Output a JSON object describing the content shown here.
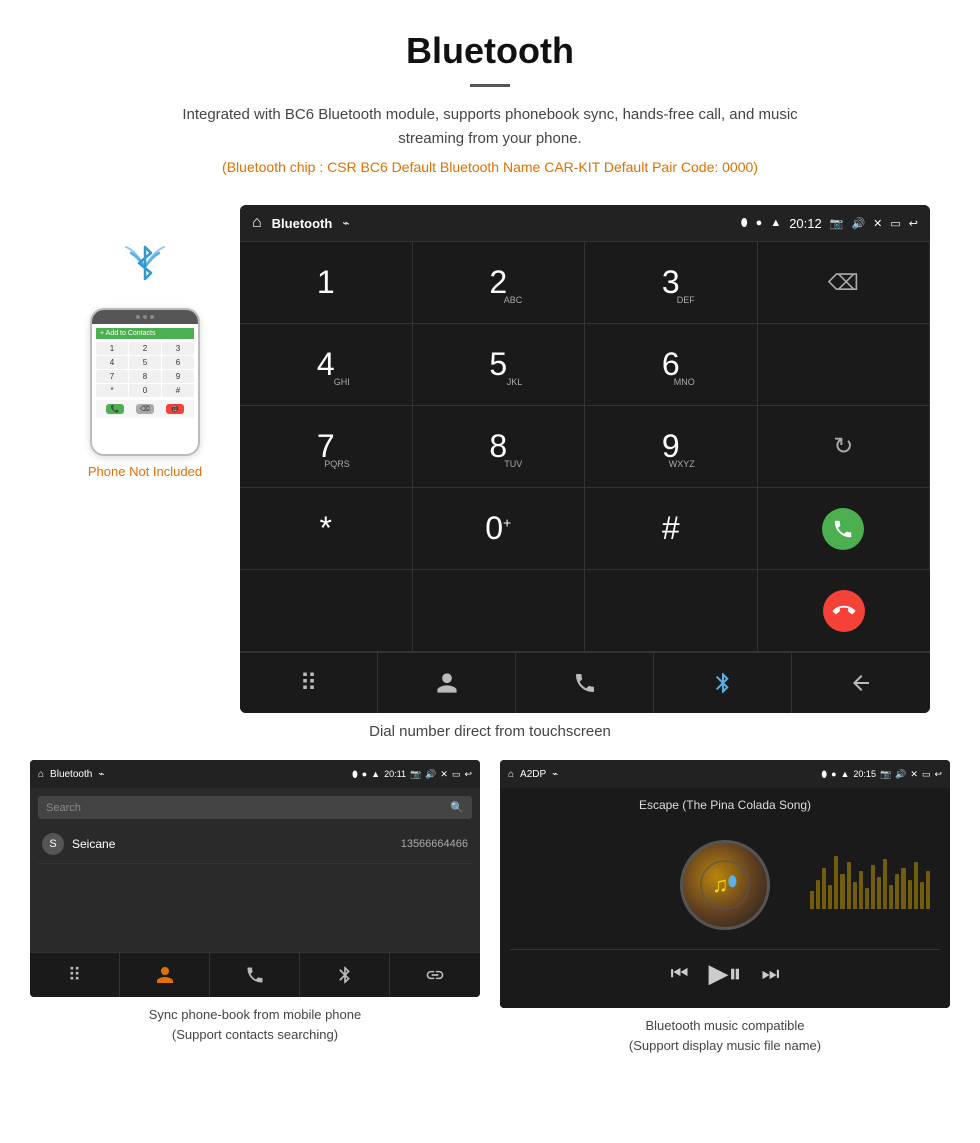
{
  "header": {
    "title": "Bluetooth",
    "description": "Integrated with BC6 Bluetooth module, supports phonebook sync, hands-free call, and music streaming from your phone.",
    "specs": "(Bluetooth chip : CSR BC6    Default Bluetooth Name CAR-KIT    Default Pair Code: 0000)"
  },
  "phone_label": "Phone Not Included",
  "dial_screen": {
    "status_bar": {
      "title": "Bluetooth",
      "usb": "⌁",
      "time": "20:12"
    },
    "keys": [
      {
        "num": "1",
        "sub": ""
      },
      {
        "num": "2",
        "sub": "ABC"
      },
      {
        "num": "3",
        "sub": "DEF"
      },
      {
        "num": "",
        "sub": ""
      },
      {
        "num": "4",
        "sub": "GHI"
      },
      {
        "num": "5",
        "sub": "JKL"
      },
      {
        "num": "6",
        "sub": "MNO"
      },
      {
        "num": "",
        "sub": ""
      },
      {
        "num": "7",
        "sub": "PQRS"
      },
      {
        "num": "8",
        "sub": "TUV"
      },
      {
        "num": "9",
        "sub": "WXYZ"
      },
      {
        "num": "",
        "sub": ""
      },
      {
        "num": "*",
        "sub": ""
      },
      {
        "num": "0",
        "sub": "+"
      },
      {
        "num": "#",
        "sub": ""
      },
      {
        "num": "",
        "sub": ""
      }
    ]
  },
  "dial_caption": "Dial number direct from touchscreen",
  "phonebook_screen": {
    "status_bar_title": "Bluetooth",
    "status_bar_time": "20:11",
    "search_placeholder": "Search",
    "contacts": [
      {
        "letter": "S",
        "name": "Seicane",
        "number": "13566664466"
      }
    ]
  },
  "phonebook_caption": "Sync phone-book from mobile phone\n(Support contacts searching)",
  "music_screen": {
    "status_bar_title": "A2DP",
    "status_bar_time": "20:15",
    "song_title": "Escape (The Pina Colada Song)"
  },
  "music_caption": "Bluetooth music compatible\n(Support display music file name)",
  "eq_heights": [
    30,
    50,
    70,
    40,
    90,
    60,
    80,
    45,
    65,
    35,
    75,
    55,
    85,
    40,
    60,
    70,
    50,
    80,
    45,
    65
  ]
}
